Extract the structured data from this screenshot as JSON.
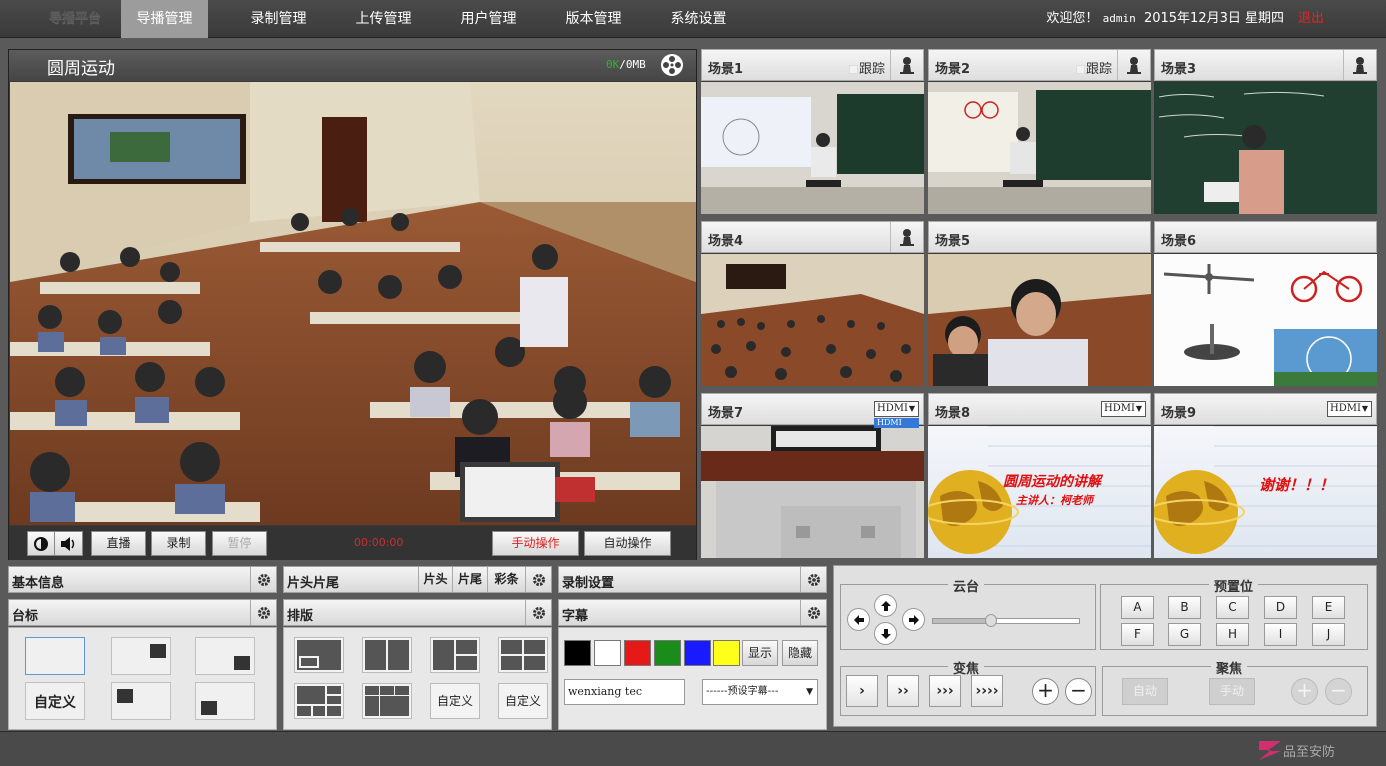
{
  "app": {
    "logo": "导播平台"
  },
  "nav": {
    "items": [
      "导播管理",
      "录制管理",
      "上传管理",
      "用户管理",
      "版本管理",
      "系统设置"
    ],
    "active": "导播管理"
  },
  "user": {
    "welcome": "欢迎您！",
    "name": "admin",
    "date": "2015年12月3日 星期四",
    "logout": "退出"
  },
  "main_video": {
    "title": "圆周运动",
    "rate_value": "0K",
    "rate_size": "/0MB",
    "time": "00:00:00",
    "controls": {
      "live": "直播",
      "record": "录制",
      "pause": "暂停",
      "manual": "手动操作",
      "auto": "自动操作"
    }
  },
  "scenes": [
    {
      "name": "场景1",
      "track": "跟踪",
      "has_person": true
    },
    {
      "name": "场景2",
      "track": "跟踪",
      "has_person": true
    },
    {
      "name": "场景3",
      "has_person": true
    },
    {
      "name": "场景4",
      "has_person": true
    },
    {
      "name": "场景5"
    },
    {
      "name": "场景6"
    },
    {
      "name": "场景7",
      "source": "HDMI",
      "dropdown_option": "HDMI"
    },
    {
      "name": "场景8",
      "source": "HDMI"
    },
    {
      "name": "场景9",
      "source": "HDMI"
    }
  ],
  "scene_slides": {
    "s8_title": "圆周运动的讲解",
    "s8_sub": "主讲人：柯老师",
    "s9_title": "谢谢！！！"
  },
  "panels": {
    "basic_info": "基本信息",
    "station_logo": "台标",
    "custom": "自定义",
    "head_tail": "片头片尾",
    "head": "片头",
    "tail": "片尾",
    "colorbar": "彩条",
    "layout": "排版",
    "layout_custom1": "自定义",
    "layout_custom2": "自定义",
    "record_settings": "录制设置",
    "subtitle": "字幕",
    "show": "显示",
    "hide": "隐藏",
    "subtitle_text": "wenxiang tec",
    "subtitle_preset": "------预设字幕---"
  },
  "subtitle_colors": [
    "#000000",
    "#ffffff",
    "#e61919",
    "#1a8c1a",
    "#1a1aff",
    "#ffff1a"
  ],
  "ptz": {
    "pan_tilt": "云台",
    "preset": "预置位",
    "zoom": "变焦",
    "focus": "聚焦",
    "preset_keys": [
      "A",
      "B",
      "C",
      "D",
      "E",
      "F",
      "G",
      "H",
      "I",
      "J"
    ],
    "zoom_keys": [
      "›",
      "››",
      "›››",
      "››››"
    ],
    "focus_auto": "自动",
    "focus_manual": "手动",
    "speed_level": 0.4
  },
  "footer": {
    "brand": "品至安防"
  }
}
